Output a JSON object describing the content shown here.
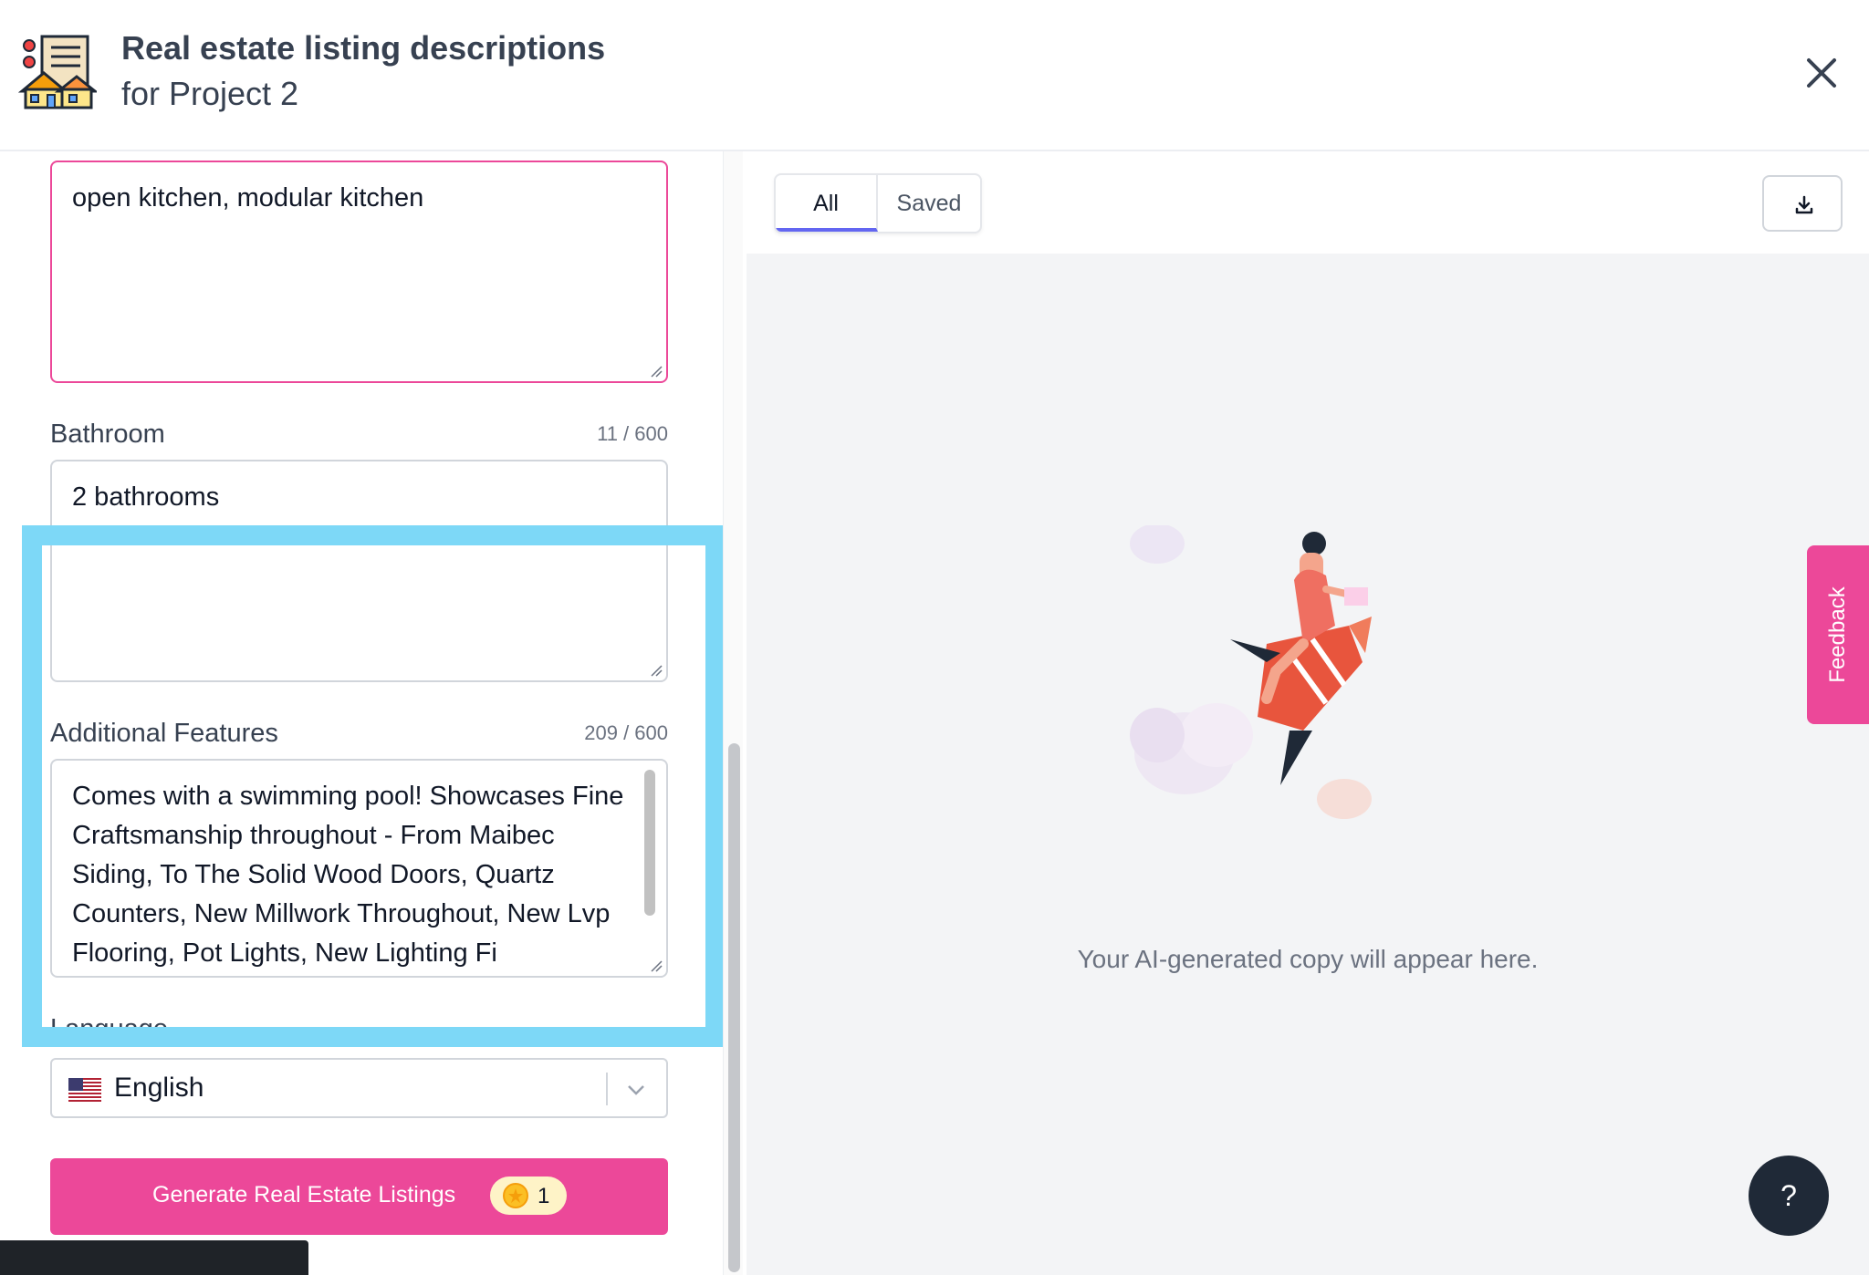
{
  "header": {
    "title": "Real estate listing descriptions",
    "subtitle": "for Project 2"
  },
  "fields": {
    "kitchen": {
      "value": "open kitchen, modular kitchen"
    },
    "bathroom": {
      "label": "Bathroom",
      "counter": "11 / 600",
      "value": "2 bathrooms"
    },
    "additional": {
      "label": "Additional Features",
      "counter": "209 / 600",
      "value": "Comes with a swimming pool! Showcases Fine Craftsmanship throughout - From Maibec Siding, To The Solid Wood Doors, Quartz Counters, New Millwork Throughout, New Lvp Flooring, Pot Lights, New Lighting Fi"
    },
    "language": {
      "label": "Language",
      "value": "English"
    }
  },
  "generate_button": {
    "label": "Generate Real Estate Listings",
    "credits": "1"
  },
  "tabs": {
    "all": "All",
    "saved": "Saved"
  },
  "empty_state": {
    "message": "Your AI-generated copy will appear here."
  },
  "feedback": {
    "label": "Feedback"
  },
  "help": {
    "label": "?"
  },
  "colors": {
    "accent": "#ec4899",
    "highlight": "#7dd8f7",
    "tab_indicator": "#6366f1"
  }
}
